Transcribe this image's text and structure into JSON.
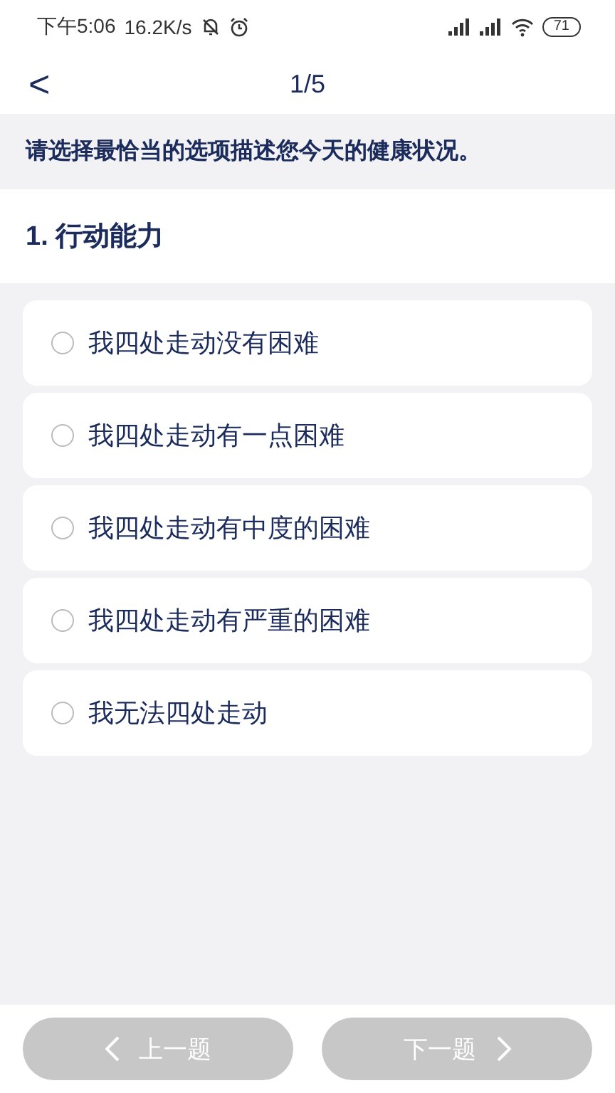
{
  "status_bar": {
    "time": "下午5:06",
    "speed": "16.2K/s",
    "battery": "71"
  },
  "header": {
    "back": "<",
    "title": "1/5"
  },
  "instruction": "请选择最恰当的选项描述您今天的健康状况。",
  "question": {
    "title": "1. 行动能力",
    "options": [
      {
        "label": "我四处走动没有困难",
        "selected": false
      },
      {
        "label": "我四处走动有一点困难",
        "selected": false
      },
      {
        "label": "我四处走动有中度的困难",
        "selected": false
      },
      {
        "label": "我四处走动有严重的困难",
        "selected": false
      },
      {
        "label": "我无法四处走动",
        "selected": false
      }
    ]
  },
  "footer": {
    "prev": {
      "label": "上一题",
      "disabled": true
    },
    "next": {
      "label": "下一题",
      "disabled": true
    }
  }
}
